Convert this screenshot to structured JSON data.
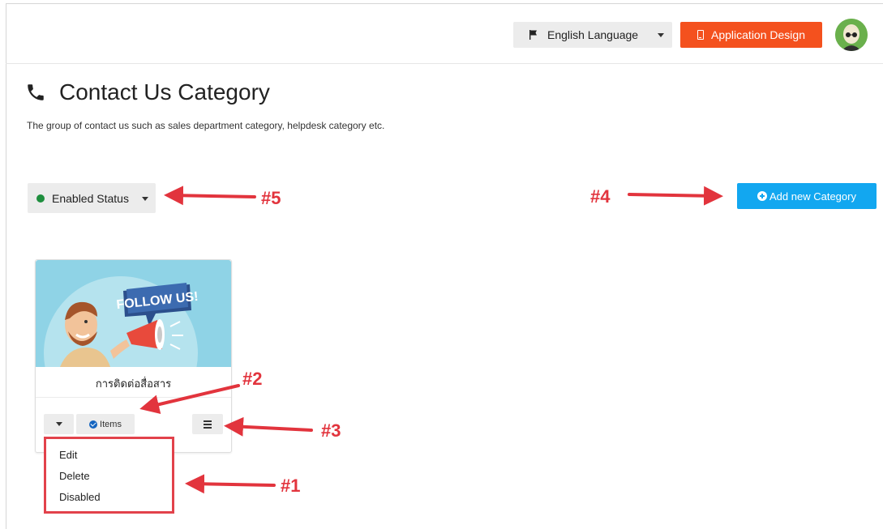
{
  "header": {
    "language_label": "English Language",
    "app_design_label": "Application Design",
    "colors": {
      "app_design_bg": "#f4511e",
      "avatar_bg": "#6ab04c"
    }
  },
  "page": {
    "title": "Contact Us Category",
    "title_icon": "phone-icon",
    "description": "The group of contact us such as sales department category, helpdesk category etc."
  },
  "status_filter": {
    "label": "Enabled Status",
    "dot_color": "#1e8e3e"
  },
  "add_button": {
    "label": "Add new Category",
    "color": "#12a7f0"
  },
  "card": {
    "image_text": "FOLLOW US!",
    "title": "การติดต่อสื่อสาร",
    "items_label": "Items"
  },
  "dropdown_menu": {
    "items": [
      "Edit",
      "Delete",
      "Disabled"
    ]
  },
  "annotations": {
    "a1": "#1",
    "a2": "#2",
    "a3": "#3",
    "a4": "#4",
    "a5": "#5",
    "color": "#e2343d"
  }
}
